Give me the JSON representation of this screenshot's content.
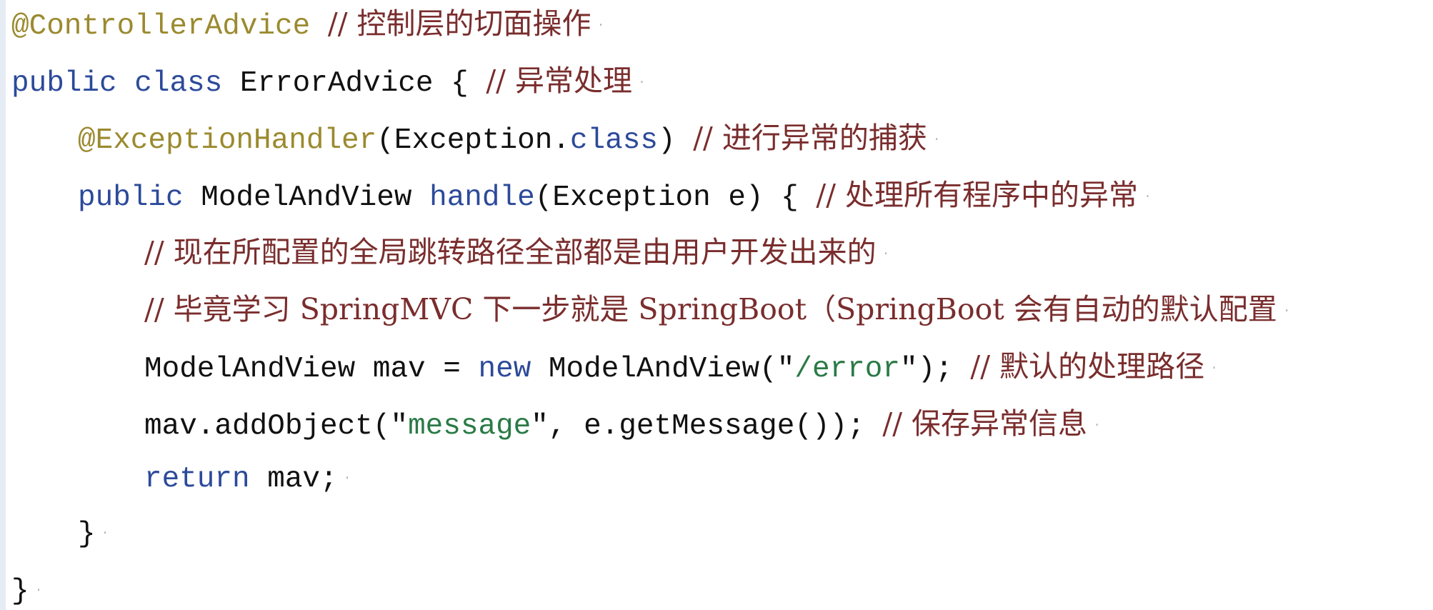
{
  "colors": {
    "annotation": "#9b8a2f",
    "keyword": "#2c4a9a",
    "string": "#2a7a45",
    "comment": "#7a2d2d",
    "text": "#111111",
    "gutter": "#e6ecf4"
  },
  "lines": [
    [
      {
        "text": "@ControllerAdvice",
        "type": "annotation"
      },
      {
        "text": " ",
        "type": "plain"
      },
      {
        "text": "// 控制层的切面操作",
        "type": "comment"
      }
    ],
    [
      {
        "text": "public",
        "type": "keyword"
      },
      {
        "text": " ",
        "type": "plain"
      },
      {
        "text": "class",
        "type": "keyword"
      },
      {
        "text": " ErrorAdvice { ",
        "type": "plain"
      },
      {
        "text": "// 异常处理",
        "type": "comment"
      }
    ],
    [
      {
        "text": "@ExceptionHandler",
        "type": "annotation"
      },
      {
        "text": "(Exception.",
        "type": "plain"
      },
      {
        "text": "class",
        "type": "keyword"
      },
      {
        "text": ") ",
        "type": "plain"
      },
      {
        "text": "// 进行异常的捕获",
        "type": "comment"
      }
    ],
    [
      {
        "text": "public",
        "type": "keyword"
      },
      {
        "text": " ModelAndView ",
        "type": "plain"
      },
      {
        "text": "handle",
        "type": "keyword"
      },
      {
        "text": "(Exception e) { ",
        "type": "plain"
      },
      {
        "text": "// 处理所有程序中的异常",
        "type": "comment"
      }
    ],
    [
      {
        "text": "// 现在所配置的全局跳转路径全部都是由用户开发出来的",
        "type": "comment"
      }
    ],
    [
      {
        "text": "// 毕竟学习 SpringMVC 下一步就是 SpringBoot（SpringBoot 会有自动的默认配置",
        "type": "comment"
      }
    ],
    [
      {
        "text": "ModelAndView mav = ",
        "type": "plain"
      },
      {
        "text": "new",
        "type": "keyword"
      },
      {
        "text": " ModelAndView(\"",
        "type": "plain"
      },
      {
        "text": "/error",
        "type": "string"
      },
      {
        "text": "\"); ",
        "type": "plain"
      },
      {
        "text": "// 默认的处理路径",
        "type": "comment"
      }
    ],
    [
      {
        "text": "mav.addObject(\"",
        "type": "plain"
      },
      {
        "text": "message",
        "type": "string"
      },
      {
        "text": "\", e.getMessage()); ",
        "type": "plain"
      },
      {
        "text": "// 保存异常信息",
        "type": "comment"
      }
    ],
    [
      {
        "text": "return",
        "type": "keyword"
      },
      {
        "text": " mav;",
        "type": "plain"
      }
    ],
    [
      {
        "text": "}",
        "type": "plain"
      }
    ],
    [
      {
        "text": "}",
        "type": "plain"
      }
    ]
  ]
}
